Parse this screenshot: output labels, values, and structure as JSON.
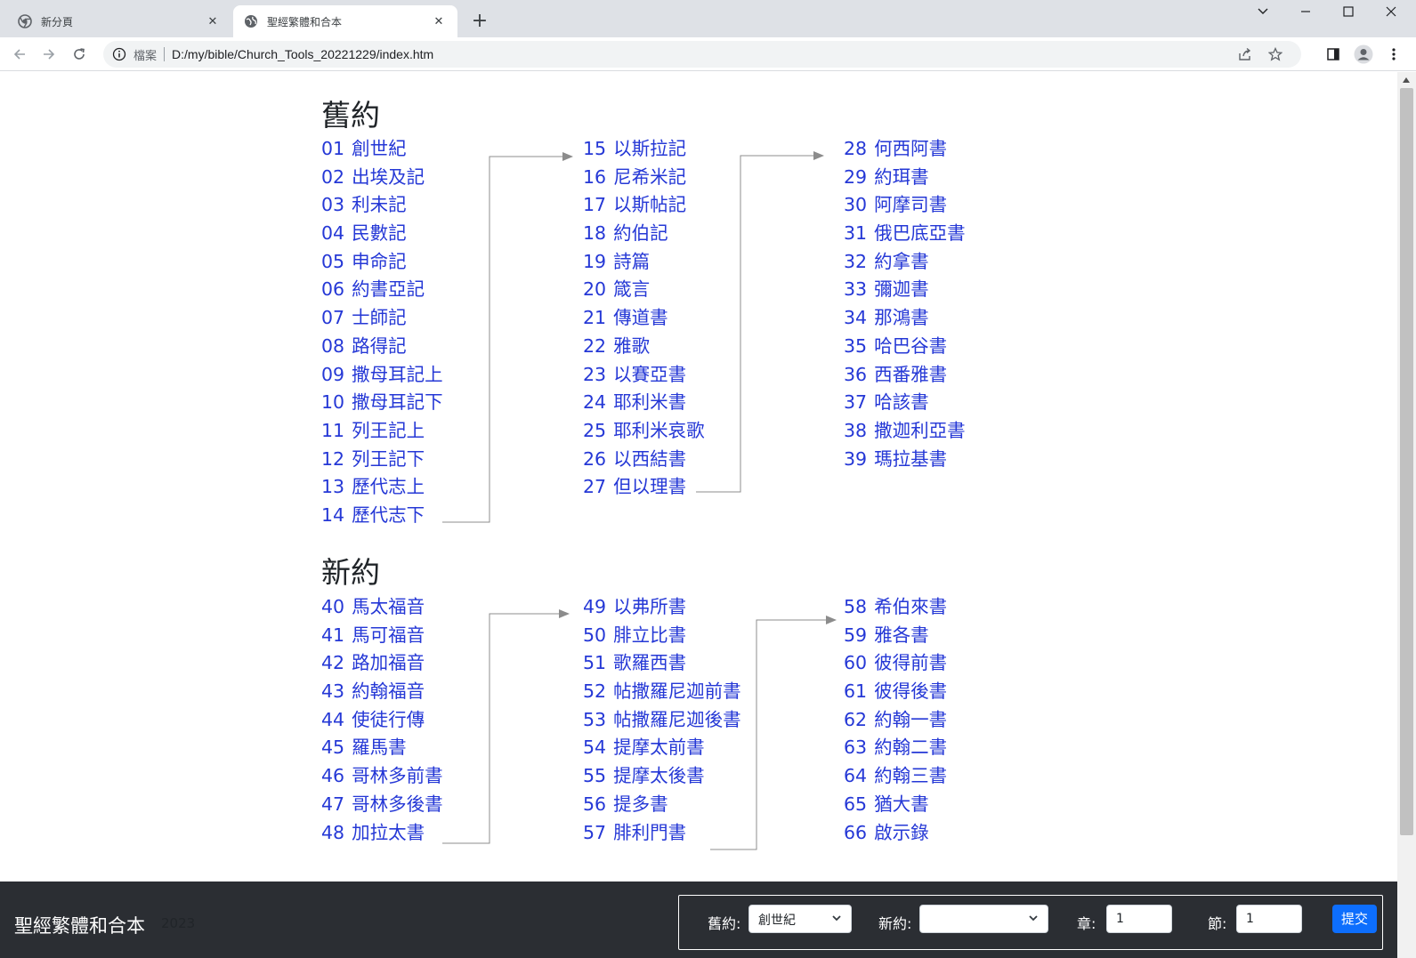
{
  "browser": {
    "tabs": [
      {
        "title": "新分頁",
        "close": "✕"
      },
      {
        "title": "聖經繁體和合本",
        "close": "✕"
      }
    ],
    "new_tab": "+",
    "omnibox": {
      "chip": "檔案",
      "url": "D:/my/bible/Church_Tools_20221229/index.htm"
    }
  },
  "old_testament": {
    "title": "舊約",
    "columns": [
      [
        {
          "num": "01",
          "name": "創世紀"
        },
        {
          "num": "02",
          "name": "出埃及記"
        },
        {
          "num": "03",
          "name": "利未記"
        },
        {
          "num": "04",
          "name": "民數記"
        },
        {
          "num": "05",
          "name": "申命記"
        },
        {
          "num": "06",
          "name": "約書亞記"
        },
        {
          "num": "07",
          "name": "士師記"
        },
        {
          "num": "08",
          "name": "路得記"
        },
        {
          "num": "09",
          "name": "撒母耳記上"
        },
        {
          "num": "10",
          "name": "撒母耳記下"
        },
        {
          "num": "11",
          "name": "列王記上"
        },
        {
          "num": "12",
          "name": "列王記下"
        },
        {
          "num": "13",
          "name": "歷代志上"
        },
        {
          "num": "14",
          "name": "歷代志下"
        }
      ],
      [
        {
          "num": "15",
          "name": "以斯拉記"
        },
        {
          "num": "16",
          "name": "尼希米記"
        },
        {
          "num": "17",
          "name": "以斯帖記"
        },
        {
          "num": "18",
          "name": "約伯記"
        },
        {
          "num": "19",
          "name": "詩篇"
        },
        {
          "num": "20",
          "name": "箴言"
        },
        {
          "num": "21",
          "name": "傳道書"
        },
        {
          "num": "22",
          "name": "雅歌"
        },
        {
          "num": "23",
          "name": "以賽亞書"
        },
        {
          "num": "24",
          "name": "耶利米書"
        },
        {
          "num": "25",
          "name": "耶利米哀歌"
        },
        {
          "num": "26",
          "name": "以西結書"
        },
        {
          "num": "27",
          "name": "但以理書"
        }
      ],
      [
        {
          "num": "28",
          "name": "何西阿書"
        },
        {
          "num": "29",
          "name": "約珥書"
        },
        {
          "num": "30",
          "name": "阿摩司書"
        },
        {
          "num": "31",
          "name": "俄巴底亞書"
        },
        {
          "num": "32",
          "name": "約拿書"
        },
        {
          "num": "33",
          "name": "彌迦書"
        },
        {
          "num": "34",
          "name": "那鴻書"
        },
        {
          "num": "35",
          "name": "哈巴谷書"
        },
        {
          "num": "36",
          "name": "西番雅書"
        },
        {
          "num": "37",
          "name": "哈該書"
        },
        {
          "num": "38",
          "name": "撒迦利亞書"
        },
        {
          "num": "39",
          "name": "瑪拉基書"
        }
      ]
    ]
  },
  "new_testament": {
    "title": "新約",
    "columns": [
      [
        {
          "num": "40",
          "name": "馬太福音"
        },
        {
          "num": "41",
          "name": "馬可福音"
        },
        {
          "num": "42",
          "name": "路加福音"
        },
        {
          "num": "43",
          "name": "約翰福音"
        },
        {
          "num": "44",
          "name": "使徒行傳"
        },
        {
          "num": "45",
          "name": "羅馬書"
        },
        {
          "num": "46",
          "name": "哥林多前書"
        },
        {
          "num": "47",
          "name": "哥林多後書"
        },
        {
          "num": "48",
          "name": "加拉太書"
        }
      ],
      [
        {
          "num": "49",
          "name": "以弗所書"
        },
        {
          "num": "50",
          "name": "腓立比書"
        },
        {
          "num": "51",
          "name": "歌羅西書"
        },
        {
          "num": "52",
          "name": "帖撒羅尼迦前書"
        },
        {
          "num": "53",
          "name": "帖撒羅尼迦後書"
        },
        {
          "num": "54",
          "name": "提摩太前書"
        },
        {
          "num": "55",
          "name": "提摩太後書"
        },
        {
          "num": "56",
          "name": "提多書"
        },
        {
          "num": "57",
          "name": "腓利門書"
        }
      ],
      [
        {
          "num": "58",
          "name": "希伯來書"
        },
        {
          "num": "59",
          "name": "雅各書"
        },
        {
          "num": "60",
          "name": "彼得前書"
        },
        {
          "num": "61",
          "name": "彼得後書"
        },
        {
          "num": "62",
          "name": "約翰一書"
        },
        {
          "num": "63",
          "name": "約翰二書"
        },
        {
          "num": "64",
          "name": "約翰三書"
        },
        {
          "num": "65",
          "name": "猶大書"
        },
        {
          "num": "66",
          "name": "啟示錄"
        }
      ]
    ]
  },
  "footer": {
    "brand": "聖經繁體和合本",
    "year": "2023",
    "form": {
      "old_label": "舊約:",
      "old_selected": "創世紀",
      "new_label": "新約:",
      "new_selected": "",
      "chapter_label": "章:",
      "chapter_value": "1",
      "verse_label": "節:",
      "verse_value": "1",
      "submit": "提交"
    }
  },
  "colors": {
    "link": "#2538d6",
    "footer_bg": "#2b2e33",
    "submit_bg": "#0d6efd"
  }
}
